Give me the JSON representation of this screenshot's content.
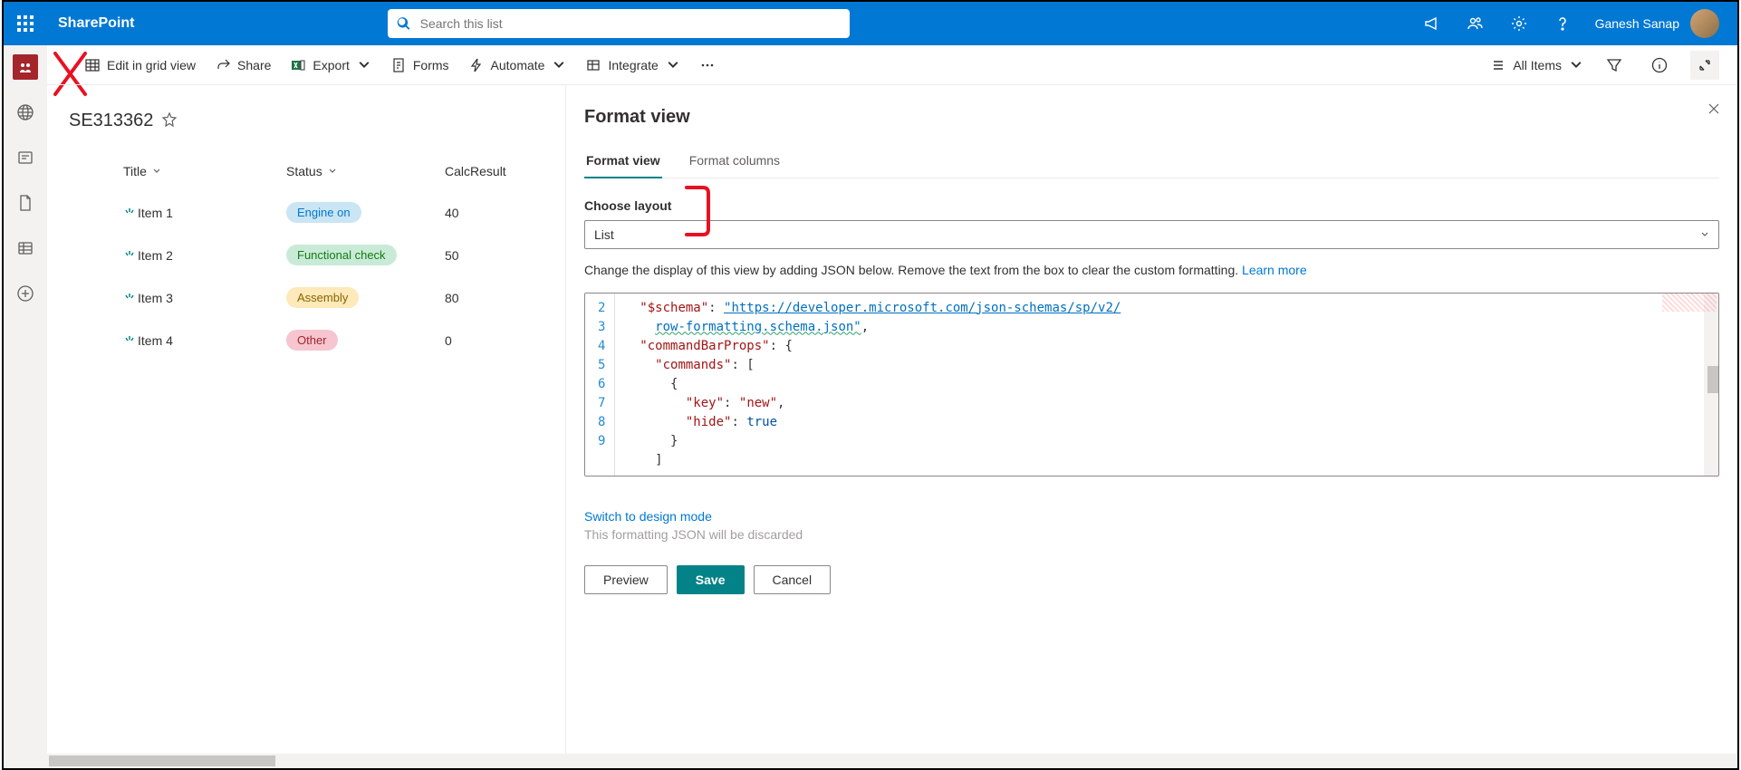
{
  "header": {
    "brand": "SharePoint",
    "search_placeholder": "Search this list",
    "user": "Ganesh Sanap"
  },
  "commandbar": {
    "edit_grid": "Edit in grid view",
    "share": "Share",
    "export": "Export",
    "forms": "Forms",
    "automate": "Automate",
    "integrate": "Integrate",
    "view": "All Items"
  },
  "list": {
    "title": "SE313362",
    "columns": {
      "title": "Title",
      "status": "Status",
      "calc": "CalcResult"
    },
    "rows": [
      {
        "title": "Item 1",
        "status": "Engine on",
        "pill": "pill-blue",
        "calc": "40"
      },
      {
        "title": "Item 2",
        "status": "Functional check",
        "pill": "pill-green",
        "calc": "50"
      },
      {
        "title": "Item 3",
        "status": "Assembly",
        "pill": "pill-yellow",
        "calc": "80"
      },
      {
        "title": "Item 4",
        "status": "Other",
        "pill": "pill-red",
        "calc": "0"
      }
    ]
  },
  "panel": {
    "title": "Format view",
    "tab_view": "Format view",
    "tab_columns": "Format columns",
    "choose_layout": "Choose layout",
    "layout": "List",
    "help": "Change the display of this view by adding JSON below. Remove the text from the box to clear the custom formatting. ",
    "learn_more": "Learn more",
    "design_link": "Switch to design mode",
    "design_sub": "This formatting JSON will be discarded",
    "preview": "Preview",
    "save": "Save",
    "cancel": "Cancel",
    "editor": {
      "lines": [
        "2",
        "3",
        "4",
        "5",
        "6",
        "7",
        "8",
        "9"
      ],
      "schema_key": "\"$schema\"",
      "schema_url1": "\"https://developer.microsoft.com/json-schemas/sp/v2/",
      "schema_url2": "row-formatting.schema.json\"",
      "cbp": "\"commandBarProps\"",
      "commands": "\"commands\"",
      "key": "\"key\"",
      "key_v": "\"new\"",
      "hide": "\"hide\"",
      "hide_v": "true"
    }
  }
}
